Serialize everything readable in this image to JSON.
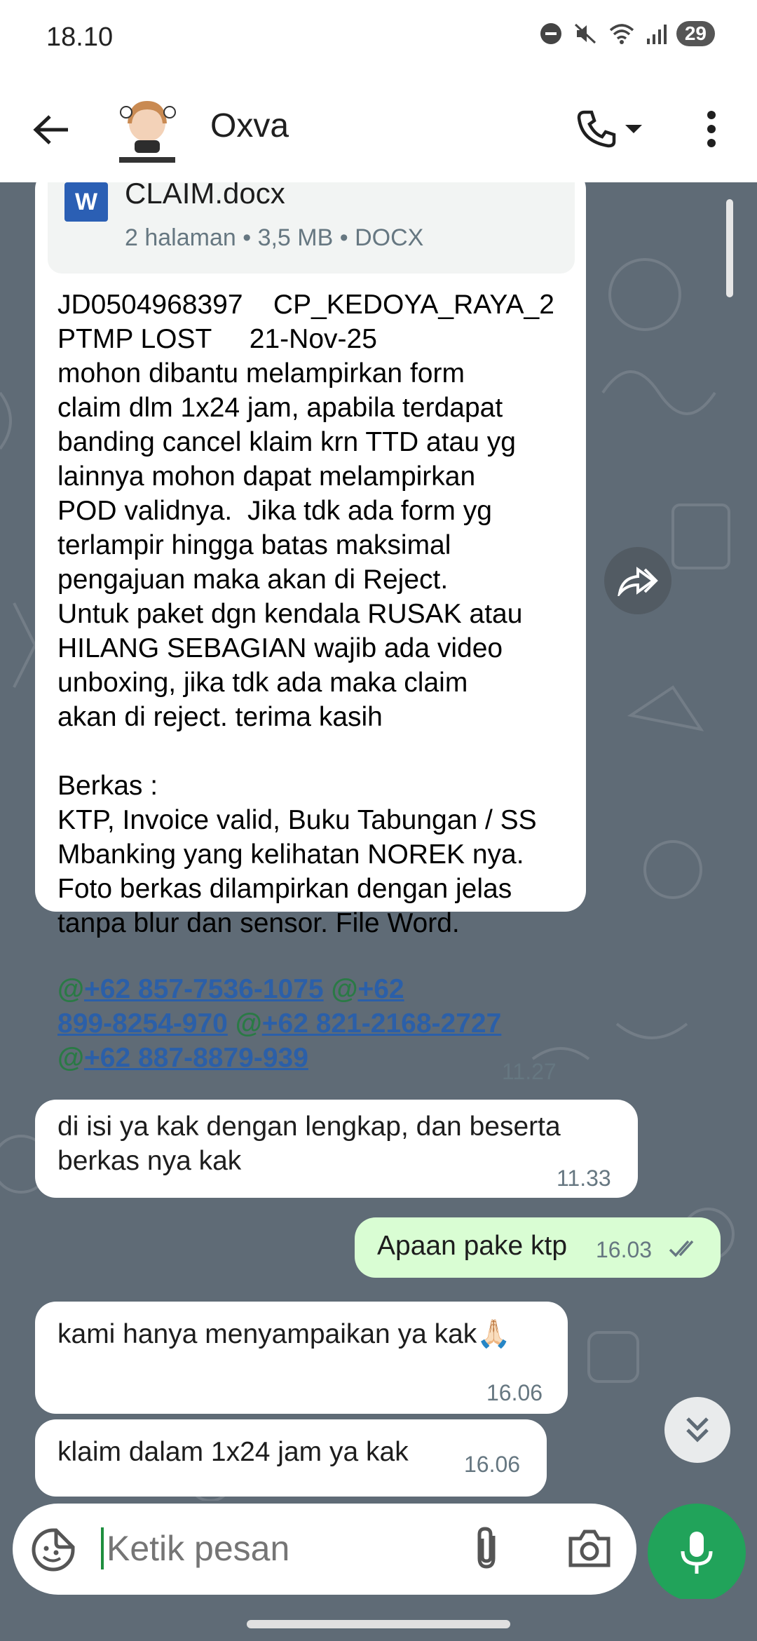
{
  "status_bar": {
    "time": "18.10",
    "battery": "29"
  },
  "header": {
    "contact_name": "Oxva"
  },
  "document": {
    "name": "CLAIM.docx",
    "meta": "2 halaman • 3,5 MB • DOCX",
    "icon_letter": "W"
  },
  "messages": {
    "m1": {
      "text": "JD0504968397    CP_KEDOYA_RAYA_2\nPTMP LOST     21-Nov-25\nmohon dibantu melampirkan form\nclaim dlm 1x24 jam, apabila terdapat\nbanding cancel klaim krn TTD atau yg\nlainnya mohon dapat melampirkan\nPOD validnya.  Jika tdk ada form yg\nterlampir hingga batas maksimal\npengajuan maka akan di Reject.\nUntuk paket dgn kendala RUSAK atau\nHILANG SEBAGIAN wajib ada video\nunboxing, jika tdk ada maka claim\nakan di reject. terima kasih\n\nBerkas :\nKTP, Invoice valid, Buku Tabungan / SS\nMbanking yang kelihatan NOREK nya.\nFoto berkas dilampirkan dengan jelas\ntanpa blur dan sensor. File Word.",
      "mention_1": "+62 857-7536-1075",
      "mention_2a": "+62",
      "mention_2b": "899-8254-970",
      "mention_3": "+62 821-2168-2727",
      "mention_4": "+62 887-8879-939",
      "at": "@",
      "time": "11.27"
    },
    "m2": {
      "text": "di isi ya kak dengan lengkap, dan beserta\nberkas nya kak",
      "time": "11.33"
    },
    "m3": {
      "text": "Apaan pake ktp",
      "time": "16.03"
    },
    "m4": {
      "text": "kami hanya menyampaikan ya kak🙏🏻",
      "time": "16.06"
    },
    "m5": {
      "text": "klaim dalam 1x24 jam ya kak",
      "time": "16.06"
    }
  },
  "composer": {
    "placeholder": "Ketik pesan"
  },
  "colors": {
    "header_bg": "#ffffff",
    "chat_bg": "#5f6b76",
    "outgoing_bubble": "#d9fdd3",
    "link": "#2b5fa8",
    "mic_button": "#21a35a"
  },
  "icons": [
    "back-arrow-icon",
    "phone-icon",
    "more-vert-icon",
    "forward-icon",
    "double-chevron-down-icon",
    "sticker-icon",
    "paperclip-icon",
    "camera-icon",
    "mic-icon",
    "read-receipt-icon"
  ]
}
